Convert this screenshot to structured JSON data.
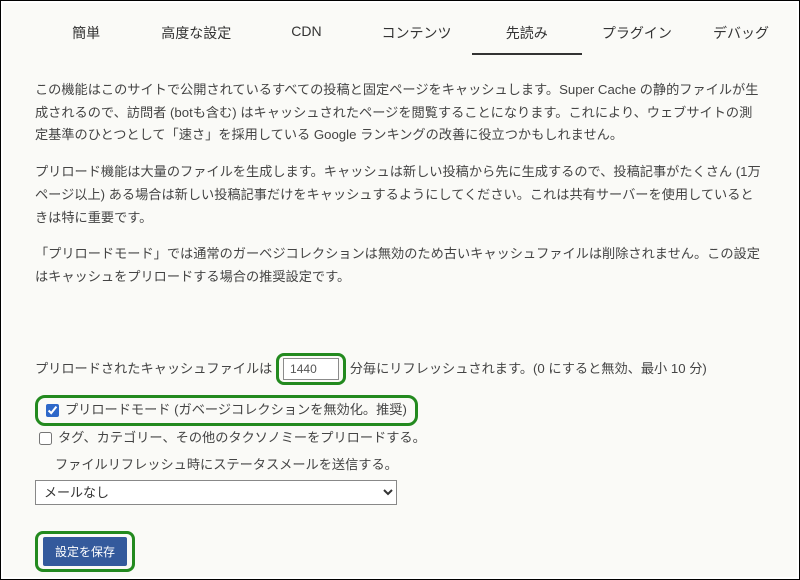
{
  "tabs": {
    "items": [
      {
        "label": "簡単"
      },
      {
        "label": "高度な設定"
      },
      {
        "label": "CDN"
      },
      {
        "label": "コンテンツ"
      },
      {
        "label": "先読み"
      },
      {
        "label": "プラグイン"
      },
      {
        "label": "デバッグ"
      }
    ],
    "activeIndex": 4
  },
  "paragraphs": {
    "p1": "この機能はこのサイトで公開されているすべての投稿と固定ページをキャッシュします。Super Cache の静的ファイルが生成されるので、訪問者 (botも含む) はキャッシュされたページを閲覧することになります。これにより、ウェブサイトの測定基準のひとつとして「速さ」を採用している Google ランキングの改善に役立つかもしれません。",
    "p2": "プリロード機能は大量のファイルを生成します。キャッシュは新しい投稿から先に生成するので、投稿記事がたくさん (1万ページ以上) ある場合は新しい投稿記事だけをキャッシュするようにしてください。これは共有サーバーを使用しているときは特に重要です。",
    "p3": "「プリロードモード」では通常のガーベジコレクションは無効のため古いキャッシュファイルは削除されません。この設定はキャッシュをプリロードする場合の推奨設定です。"
  },
  "refresh": {
    "pre": "プリロードされたキャッシュファイルは ",
    "value": "1440",
    "post": " 分毎にリフレッシュされます。(0 にすると無効、最小 10 分)"
  },
  "options": {
    "preload_mode": "プリロードモード (ガベージコレクションを無効化。推奨)",
    "taxonomy": "タグ、カテゴリー、その他のタクソノミーをプリロードする。",
    "send_mail": "ファイルリフレッシュ時にステータスメールを送信する。"
  },
  "select": {
    "selected": "メールなし"
  },
  "buttons": {
    "save": "設定を保存"
  }
}
